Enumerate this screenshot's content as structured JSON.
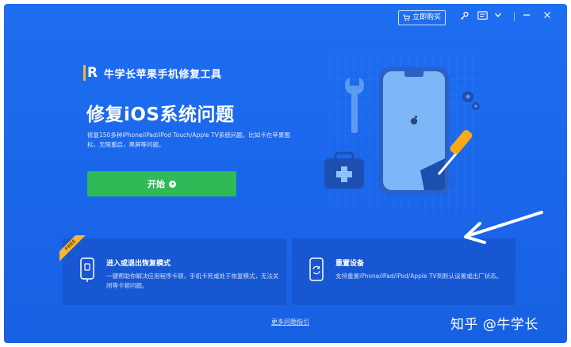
{
  "titlebar": {
    "buy_label": "立即购买",
    "icons": [
      "cart-icon",
      "key-icon",
      "feedback-icon",
      "dropdown-icon",
      "minimize-icon",
      "close-icon"
    ]
  },
  "brand": {
    "app_name": "牛学长苹果手机修复工具",
    "logo_letter": "R"
  },
  "hero": {
    "title": "修复iOS系统问题",
    "description": "修复150多种iPhone/iPad/iPod Touch/Apple TV系统问题，比如卡在苹果图标，无限重启，黑屏等问题。",
    "start_label": "开始"
  },
  "cards": [
    {
      "title": "进入或退出恢复模式",
      "description": "一键帮助你解决应用程序卡顿，手机卡死或处于恢复模式，无法关闭等卡顿问题。",
      "badge": "FREE"
    },
    {
      "title": "重置设备",
      "description": "支持重置iPhone/iPad/iPod/Apple TV到默认设置或出厂状态。"
    }
  ],
  "footer": {
    "more_link": "更多问题指引"
  },
  "watermark": "知乎 @牛学长",
  "colors": {
    "background": "#1e6ef2",
    "card": "#1757d2",
    "start_button": "#2fb957",
    "accent_yellow": "#f7b733"
  }
}
